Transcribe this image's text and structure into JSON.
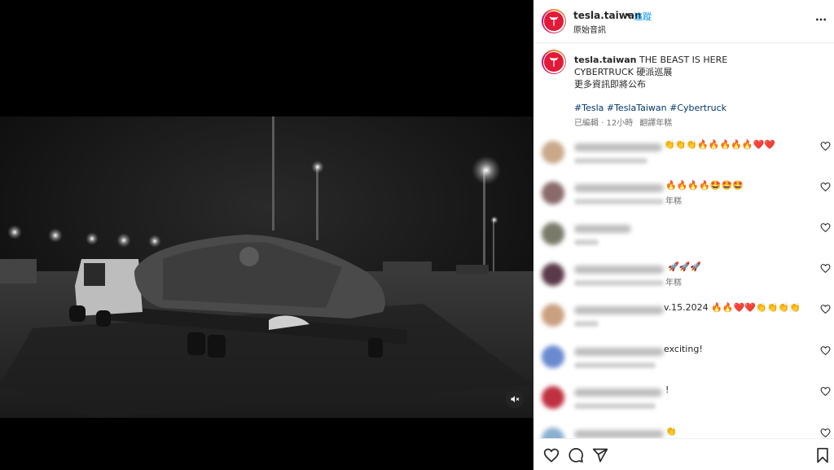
{
  "header": {
    "username": "tesla.taiwan",
    "dot": "•",
    "follow_label": "追蹤",
    "subtitle": "原始音訊"
  },
  "caption": {
    "username": "tesla.taiwan",
    "line1": "THE BEAST IS HERE",
    "line2": "CYBERTRUCK 硬派巡展",
    "line3": "更多資訊即將公布",
    "hashtags": "#Tesla #TeslaTaiwan #Cybertruck",
    "meta": "已編輯 · 12小時",
    "translate": "翻譯年糕"
  },
  "comments": [
    {
      "visible_text": "👏👏👏🔥🔥🔥🔥🔥❤️❤️",
      "sub_text": "",
      "avatar_color": "#c9a98a"
    },
    {
      "visible_text": "🔥🔥🔥🔥🤩🤩🤩",
      "sub_text": "年糕",
      "avatar_color": "#8a6a6a"
    },
    {
      "visible_text": "",
      "sub_text": "",
      "avatar_color": "#7a7a6a"
    },
    {
      "visible_text": "🚀🚀🚀",
      "sub_text": "年糕",
      "avatar_color": "#5a3a4a"
    },
    {
      "visible_text": "v.15.2024 🔥🔥❤️❤️👏👏👏👏",
      "sub_text": "",
      "avatar_color": "#c9a080"
    },
    {
      "visible_text": "exciting!",
      "sub_text": "",
      "avatar_color": "#6a8ad0"
    },
    {
      "visible_text": "!",
      "sub_text": "",
      "avatar_color": "#c03040"
    },
    {
      "visible_text": "👏",
      "sub_text": "",
      "avatar_color": "#8ab0d0"
    }
  ],
  "icons": {
    "more": "more-options-icon",
    "heart": "heart-icon",
    "comment": "comment-icon",
    "share": "share-icon",
    "bookmark": "bookmark-icon",
    "mute": "speaker-muted-icon"
  },
  "colors": {
    "follow": "#0095f6",
    "brand_red": "#e31937",
    "hashtag": "#00376b"
  }
}
